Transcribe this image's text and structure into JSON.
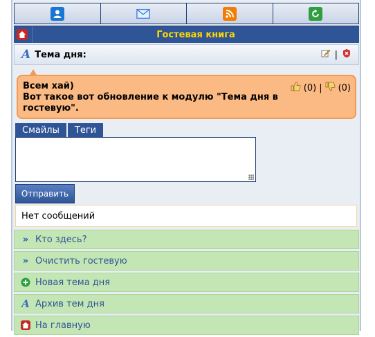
{
  "header": {
    "icons": [
      "user-icon",
      "mail-icon",
      "rss-icon",
      "refresh-icon"
    ],
    "title": "Гостевая книга"
  },
  "topic": {
    "label": "Тема дня:",
    "separator": "|"
  },
  "message": {
    "text": "Всем хай)\nВот такое вот обновление к модулю \"Тема дня в гостевую\".",
    "likes": "(0)",
    "vote_separator": "|",
    "dislikes": "(0)"
  },
  "editor": {
    "tabs": [
      "Смайлы",
      "Теги"
    ],
    "submit_label": "Отправить",
    "textarea_value": ""
  },
  "status": {
    "no_messages": "Нет сообщений"
  },
  "nav": {
    "items": [
      {
        "label": "Кто здесь?",
        "icon": "double-chevron-icon"
      },
      {
        "label": "Очистить гостевую",
        "icon": "double-chevron-icon"
      },
      {
        "label": "Новая тема дня",
        "icon": "plus-icon"
      },
      {
        "label": "Архив тем дня",
        "icon": "archive-a-icon"
      },
      {
        "label": "На главную",
        "icon": "home-icon"
      }
    ]
  },
  "colors": {
    "header_blue": "#2f5597",
    "title_yellow": "#ffd800",
    "bubble_orange": "#fbb983",
    "nav_green": "#c3e6b4"
  }
}
